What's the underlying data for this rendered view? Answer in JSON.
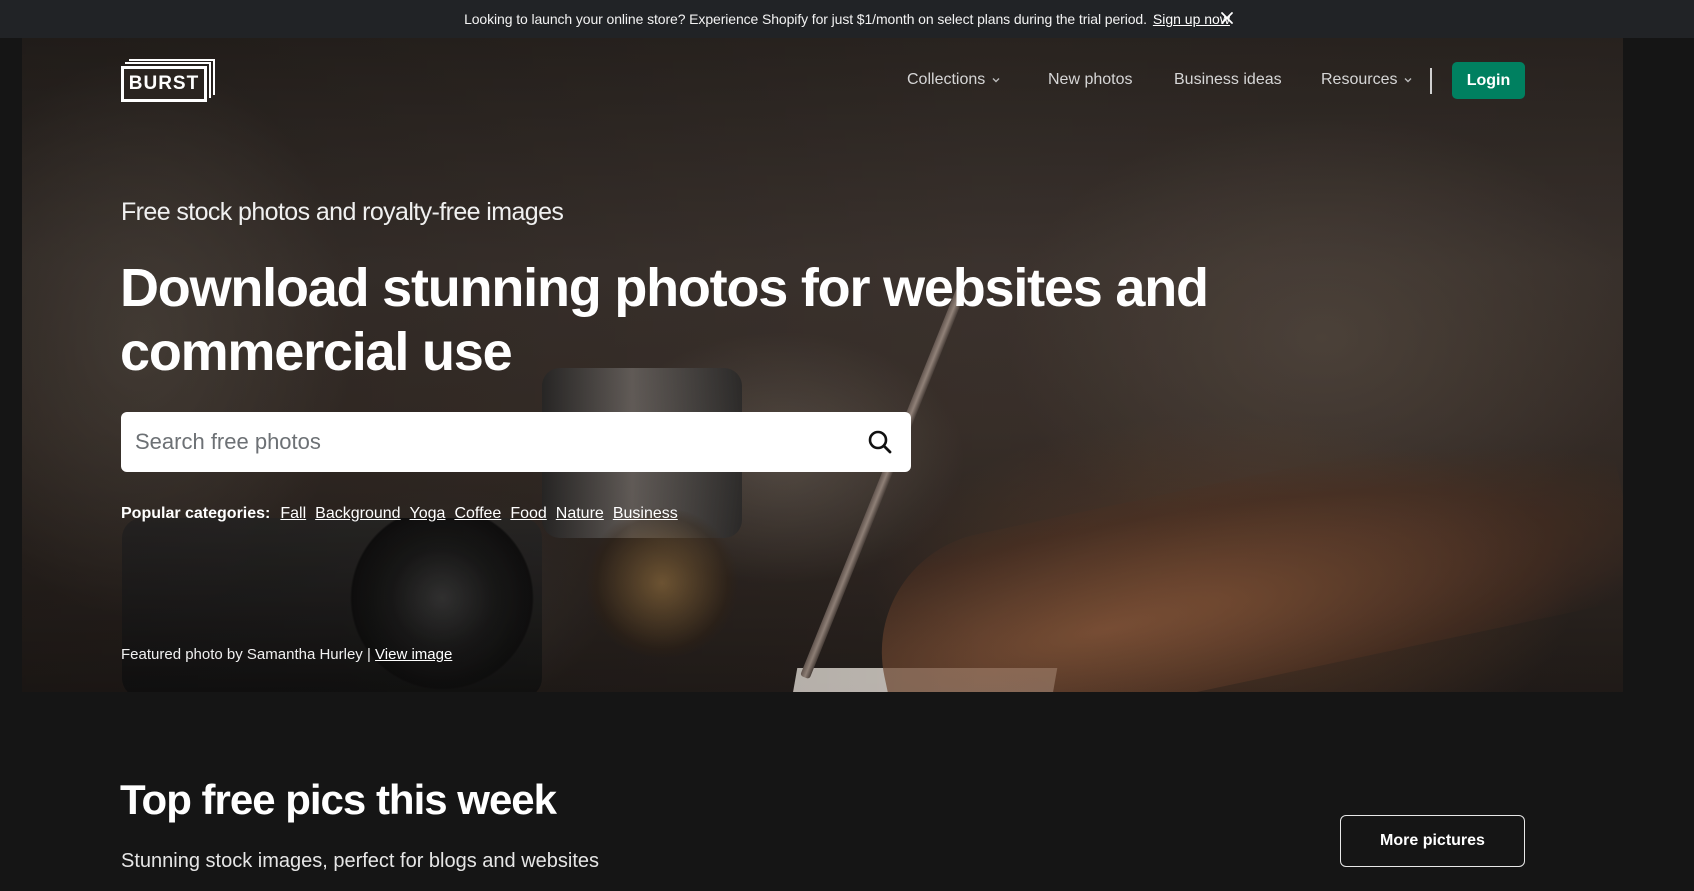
{
  "promo": {
    "text": "Looking to launch your online store? Experience Shopify for just $1/month on select plans during the trial period.",
    "link_label": "Sign up now",
    "close_icon": "close-icon"
  },
  "header": {
    "logo_text": "BURST",
    "nav": [
      {
        "label": "Collections",
        "has_dropdown": true
      },
      {
        "label": "New photos",
        "has_dropdown": false
      },
      {
        "label": "Business ideas",
        "has_dropdown": false
      },
      {
        "label": "Resources",
        "has_dropdown": true
      }
    ],
    "login_label": "Login"
  },
  "hero": {
    "subtitle": "Free stock photos and royalty-free images",
    "title": "Download stunning photos for websites and commercial use",
    "search": {
      "placeholder": "Search free photos",
      "value": "",
      "icon": "search-icon"
    },
    "popular_label": "Popular categories:",
    "categories": [
      "Fall",
      "Background",
      "Yoga",
      "Coffee",
      "Food",
      "Nature",
      "Business"
    ],
    "credit_text": "Featured photo by Samantha Hurley |",
    "credit_link": "View image"
  },
  "section": {
    "title": "Top free pics this week",
    "subtitle": "Stunning stock images, perfect for blogs and websites",
    "more_label": "More pictures"
  },
  "colors": {
    "brand_green": "#008060",
    "promo_bg": "#212326",
    "page_bg": "#151515"
  }
}
